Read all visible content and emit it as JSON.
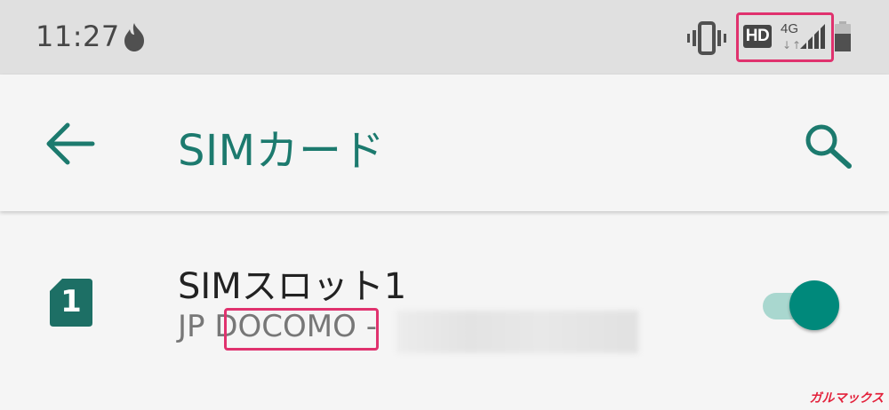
{
  "status_bar": {
    "time": "11:27",
    "hd_label": "HD",
    "network_type": "4G",
    "data_arrows": "↓↑",
    "icons": [
      "fire-icon",
      "vibrate-icon",
      "hd-voice-icon",
      "signal-icon",
      "battery-icon"
    ]
  },
  "app_bar": {
    "title": "SIMカード",
    "icons": [
      "back-arrow-icon",
      "search-icon"
    ]
  },
  "sim_slot": {
    "number": "1",
    "title": "SIMスロット1",
    "summary_prefix": "JP ",
    "carrier": "DOCOMO",
    "summary_separator": " -",
    "enabled": true
  },
  "watermark": "ガルマックス",
  "colors": {
    "accent": "#00897b",
    "title_teal": "#1c7a6e",
    "highlight": "#e0326e",
    "status_bar_bg": "#e0e0e0",
    "page_bg": "#f5f5f5"
  }
}
